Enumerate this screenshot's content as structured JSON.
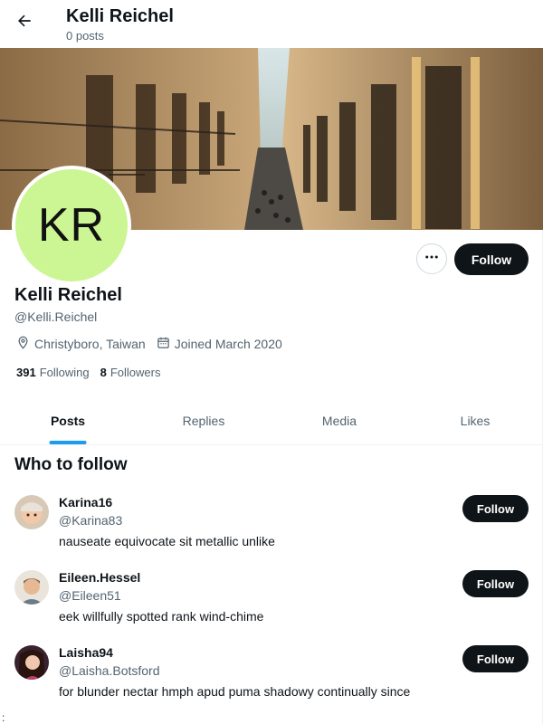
{
  "header": {
    "title": "Kelli Reichel",
    "subtitle": "0 posts"
  },
  "profile": {
    "avatar_initials": "KR",
    "avatar_color": "#ccf593",
    "name": "Kelli Reichel",
    "handle": "@Kelli.Reichel",
    "location": "Christyboro, Taiwan",
    "joined": "Joined March 2020",
    "following_count": "391",
    "following_label": "Following",
    "followers_count": "8",
    "followers_label": "Followers",
    "follow_label": "Follow"
  },
  "tabs": [
    {
      "label": "Posts",
      "active": true
    },
    {
      "label": "Replies",
      "active": false
    },
    {
      "label": "Media",
      "active": false
    },
    {
      "label": "Likes",
      "active": false
    }
  ],
  "who_to_follow": {
    "title": "Who to follow",
    "suggestions": [
      {
        "name": "Karina16",
        "handle": "@Karina83",
        "bio": "nauseate equivocate sit metallic unlike",
        "follow_label": "Follow"
      },
      {
        "name": "Eileen.Hessel",
        "handle": "@Eileen51",
        "bio": "eek willfully spotted rank wind-chime",
        "follow_label": "Follow"
      },
      {
        "name": "Laisha94",
        "handle": "@Laisha.Botsford",
        "bio": "for blunder nectar hmph apud puma shadowy continually since",
        "follow_label": "Follow"
      }
    ]
  },
  "stray_char": ":",
  "colors": {
    "accent": "#1d9bf0",
    "button_dark": "#0f1419",
    "muted_text": "#536471"
  },
  "icons": {
    "back": "arrow-left-icon",
    "more": "more-horizontal-icon",
    "location": "location-pin-icon",
    "calendar": "calendar-icon"
  }
}
